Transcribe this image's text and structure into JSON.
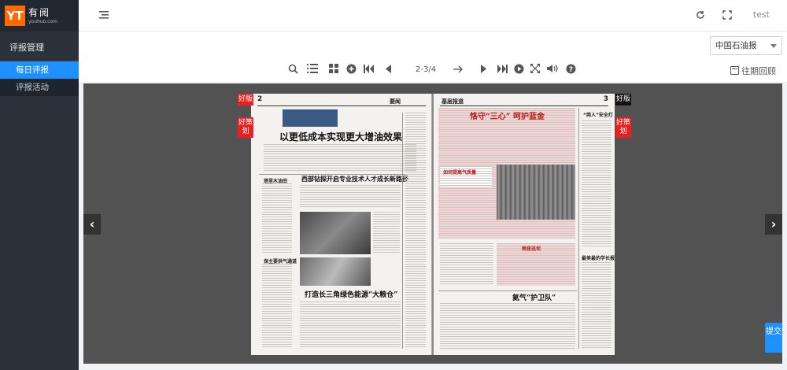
{
  "logo": {
    "box": "YT",
    "cn": "有阅",
    "en": "youhuo.com"
  },
  "sidebar": {
    "group": "评报管理",
    "items": [
      {
        "label": "每日评报"
      },
      {
        "label": "评报活动"
      }
    ]
  },
  "header": {
    "user": "test"
  },
  "select": {
    "value": "中国石油报"
  },
  "toolbar": {
    "page_indicator": "2-3/4",
    "history_label": "往期回顾"
  },
  "tags": {
    "good_page": "好版",
    "good_plan": "好策划"
  },
  "newspaper": {
    "left_page_num": "2",
    "right_page_num": "3",
    "left_masthead": "要闻",
    "right_masthead": "基层报道",
    "left_headline_1": "以更低成本实现更大增油效果",
    "left_headline_2": "西部钻探开启专业技术人才成长新路径",
    "left_headline_3": "打造长三角绿色能源“大粮仓”",
    "left_side_1": "塔里木油田",
    "left_side_2": "保主要供气通道",
    "right_headline_1": "恪守“三心” 呵护蓝金",
    "right_headline_2": "氦气“护卫队”",
    "right_box_title": "如何提高气质量",
    "right_small_1": "“两人”安全灯",
    "right_small_2": "最美最的学长报",
    "right_night": "雨夜巡坝"
  },
  "submit_label": "提交"
}
